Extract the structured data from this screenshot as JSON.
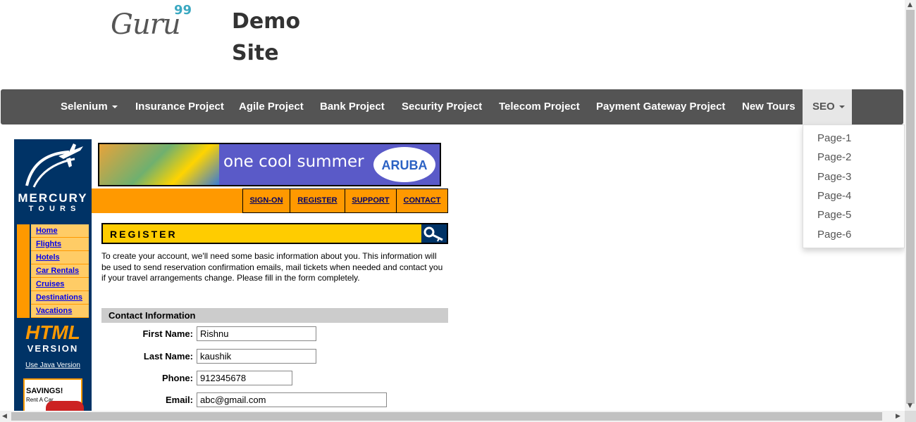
{
  "header": {
    "logo_text": "Guru",
    "logo_sup": "99",
    "site_title": "Demo Site"
  },
  "navbar": {
    "items": [
      {
        "label": "Selenium",
        "has_caret": true
      },
      {
        "label": "Insurance Project"
      },
      {
        "label": "Agile Project"
      },
      {
        "label": "Bank Project"
      },
      {
        "label": "Security Project"
      },
      {
        "label": "Telecom Project"
      },
      {
        "label": "Payment Gateway Project"
      },
      {
        "label": "New Tours"
      },
      {
        "label": "SEO",
        "has_caret": true,
        "open": true
      }
    ],
    "dropdown": [
      "Page-1",
      "Page-2",
      "Page-3",
      "Page-4",
      "Page-5",
      "Page-6"
    ]
  },
  "mercury": {
    "logo_line1": "MERCURY",
    "logo_line2": "T O U R S",
    "menu": [
      "Home",
      "Flights",
      "Hotels",
      "Car Rentals",
      "Cruises",
      "Destinations",
      "Vacations"
    ],
    "html_word": "HTML",
    "version_word": "VERSION",
    "java_link": "Use Java Version",
    "savings_title": "SAVINGS!",
    "savings_sub": "Rent A Car"
  },
  "banner": {
    "text": "one cool summer",
    "brand": "ARUBA"
  },
  "topnav": [
    "SIGN-ON",
    "REGISTER",
    "SUPPORT",
    "CONTACT"
  ],
  "register": {
    "heading": "REGISTER",
    "intro": "To create your account, we'll need some basic information about you. This information will be used to send reservation confirmation emails, mail tickets when needed and contact you if your travel arrangements change. Please fill in the form completely.",
    "section": "Contact Information",
    "fields": {
      "first_name_label": "First Name:",
      "first_name_value": "Rishnu",
      "last_name_label": "Last Name:",
      "last_name_value": "kaushik",
      "phone_label": "Phone:",
      "phone_value": "912345678",
      "email_label": "Email:",
      "email_value": "abc@gmail.com"
    }
  },
  "colors": {
    "navbar_bg": "#545454",
    "mercury_blue": "#003366",
    "mercury_orange": "#ff9900",
    "register_yellow": "#ffcc00"
  }
}
